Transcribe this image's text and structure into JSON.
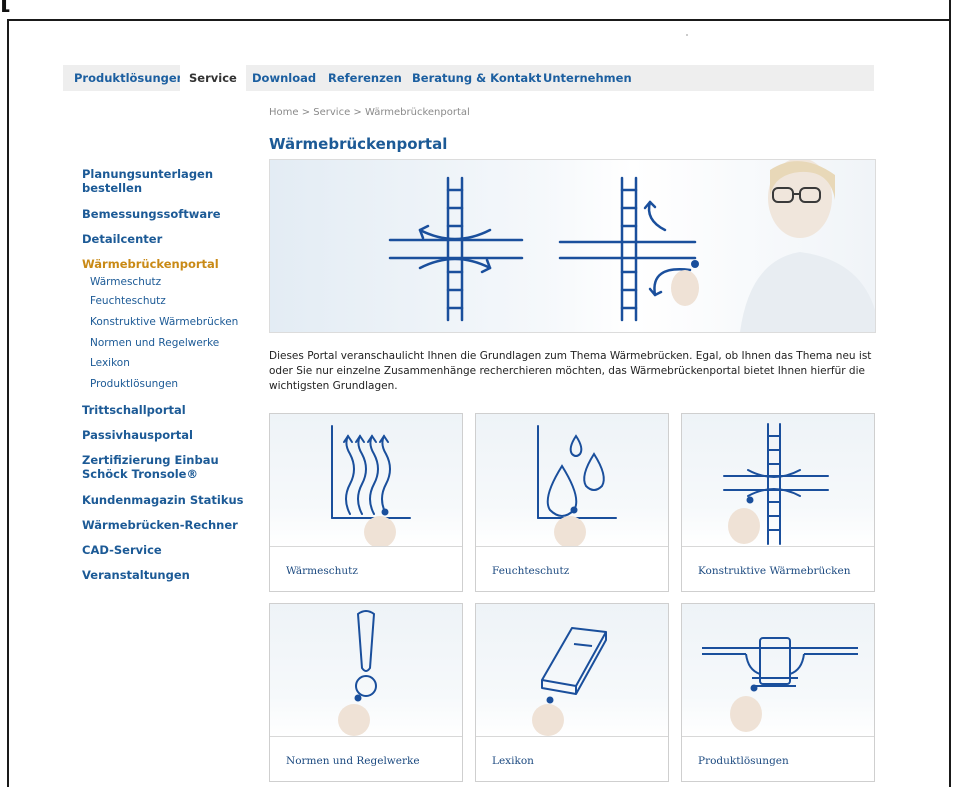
{
  "nav": {
    "items": [
      "Produktlösungen",
      "Service",
      "Download",
      "Referenzen",
      "Beratung & Kontakt",
      "Unternehmen"
    ],
    "active": "Service"
  },
  "breadcrumb": "Home > Service > Wärmebrückenportal",
  "page_title": "Wärmebrückenportal",
  "sidebar": {
    "items": [
      {
        "label": "Planungsunterlagen bestellen"
      },
      {
        "label": "Bemessungssoftware"
      },
      {
        "label": "Detailcenter"
      },
      {
        "label": "Wärmebrückenportal",
        "current": true
      },
      {
        "label": "Trittschallportal"
      },
      {
        "label": "Passivhausportal"
      },
      {
        "label": "Zertifizierung Einbau Schöck Tronsole®"
      },
      {
        "label": "Kundenmagazin Statikus"
      },
      {
        "label": "Wärmebrücken-Rechner"
      },
      {
        "label": "CAD-Service"
      },
      {
        "label": "Veranstaltungen"
      }
    ],
    "sub_items": [
      "Wärmeschutz",
      "Feuchteschutz",
      "Konstruktive Wärmebrücken",
      "Normen und Regelwerke",
      "Lexikon",
      "Produktlösungen"
    ]
  },
  "intro_text": "Dieses Portal veranschaulicht Ihnen die Grundlagen zum Thema Wärmebrücken. Egal, ob Ihnen das Thema neu ist oder Sie nur einzelne Zusammenhänge recherchieren möchten, das Wärmebrückenportal bietet Ihnen hierfür die wichtigsten Grundlagen.",
  "cards": [
    {
      "label": "Wärmeschutz",
      "icon": "heat-waves-icon"
    },
    {
      "label": "Feuchteschutz",
      "icon": "water-drops-icon"
    },
    {
      "label": "Konstruktive Wärmebrücken",
      "icon": "thermal-bridge-icon"
    },
    {
      "label": "Normen und Regelwerke",
      "icon": "exclamation-icon"
    },
    {
      "label": "Lexikon",
      "icon": "book-icon"
    },
    {
      "label": "Produktlösungen",
      "icon": "product-icon"
    }
  ],
  "colors": {
    "brand_blue": "#1c5a96",
    "active_orange": "#c98a16",
    "nav_bg": "#eeeeee"
  }
}
